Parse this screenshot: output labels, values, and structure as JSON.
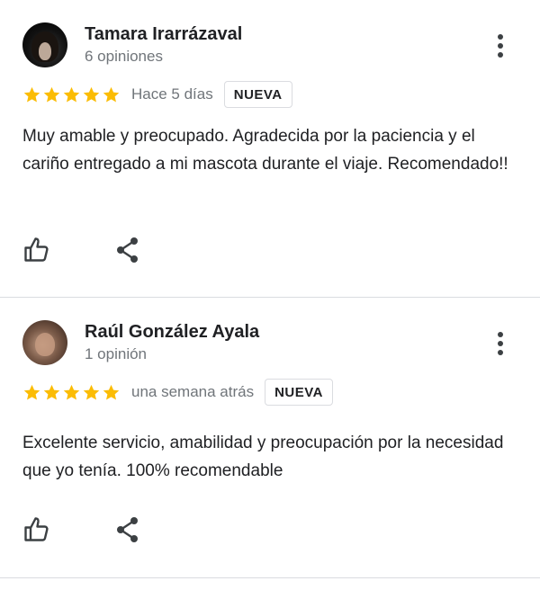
{
  "colors": {
    "star": "#fbbc04",
    "divider": "#dadce0",
    "secondary_text": "#70757a",
    "primary_text": "#202124"
  },
  "reviews": [
    {
      "author": "Tamara Irarrázaval",
      "review_count": "6 opiniones",
      "rating": 5,
      "date": "Hace 5 días",
      "badge": "NUEVA",
      "text": "Muy amable y preocupado. Agradecida por la paciencia y el cariño entregado a mi mascota durante el viaje. Recomendado!!",
      "icons": {
        "menu": "more-vert-icon",
        "like": "thumb-up-icon",
        "share": "share-icon"
      }
    },
    {
      "author": "Raúl González Ayala",
      "review_count": "1 opinión",
      "rating": 5,
      "date": "una semana atrás",
      "badge": "NUEVA",
      "text": "Excelente servicio, amabilidad y preocupación por la necesidad que yo tenía. 100% recomendable",
      "icons": {
        "menu": "more-vert-icon",
        "like": "thumb-up-icon",
        "share": "share-icon"
      }
    }
  ]
}
